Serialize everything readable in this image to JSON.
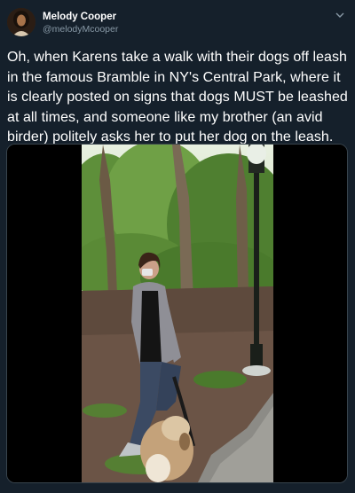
{
  "author": {
    "display_name": "Melody Cooper",
    "handle": "@melodyMcooper"
  },
  "tweet": {
    "text": "Oh, when Karens take a walk with their dogs off leash in the famous Bramble in NY's Central Park, where it is clearly posted on signs that dogs MUST be leashed at all times, and someone like my brother (an avid birder) politely asks her to put her dog on the leash."
  },
  "media": {
    "type": "video-frame",
    "description_icon": "video-still"
  },
  "colors": {
    "background": "#15202b",
    "text": "#ffffff",
    "secondary": "#8899a6",
    "border": "#38444d"
  }
}
